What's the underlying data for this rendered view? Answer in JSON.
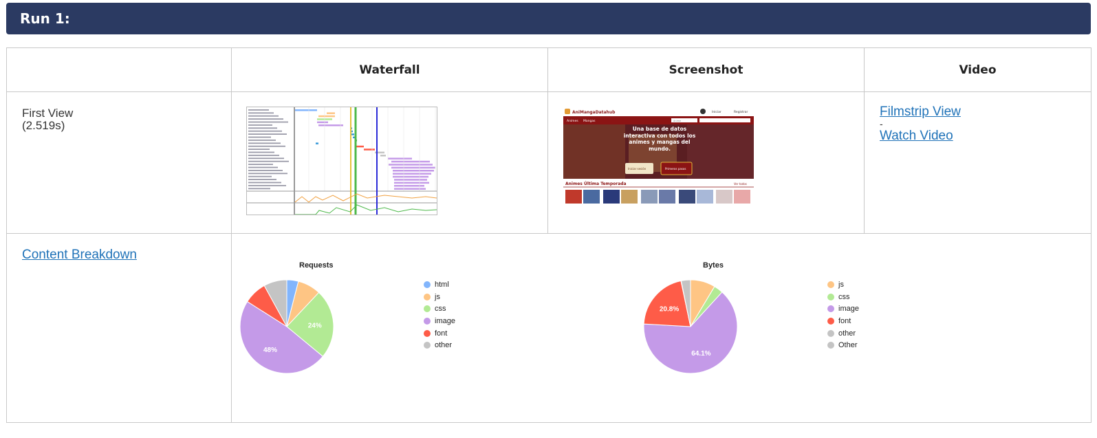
{
  "run": {
    "title": "Run 1:"
  },
  "table": {
    "headers": [
      "",
      "Waterfall",
      "Screenshot",
      "Video"
    ]
  },
  "first_view": {
    "label": "First View",
    "time": "(2.519s)",
    "filmstrip_link": "Filmstrip View",
    "separator": "-",
    "video_link": "Watch Video"
  },
  "screenshot": {
    "logo_text": "AniMangaDatahub",
    "nav": [
      "Animes",
      "Mangas"
    ],
    "user_links": [
      "Iniciar",
      "Registrar"
    ],
    "search_placeholder": "Anime",
    "hero_text": "Una base de datos interactiva con todos los animes y mangas del mundo.",
    "btn_login": "Iniciar sesión",
    "btn_start": "Primeros pasos",
    "section_title": "Animes Última Temporada",
    "see_all": "Ver todos"
  },
  "breakdown": {
    "link": "Content Breakdown"
  },
  "colors": {
    "header_bg": "#2b3a62",
    "link": "#1f72b8",
    "html": "#82b5fc",
    "js": "#fec584",
    "css": "#b2ea94",
    "image": "#c49ae8",
    "font": "#fe5c48",
    "other": "#c4c4c4"
  },
  "chart_data": [
    {
      "type": "pie",
      "title": "Requests",
      "series": [
        {
          "name": "html",
          "value": 4,
          "color": "#82b5fc"
        },
        {
          "name": "js",
          "value": 8,
          "color": "#fec584"
        },
        {
          "name": "css",
          "value": 24,
          "color": "#b2ea94"
        },
        {
          "name": "image",
          "value": 48,
          "color": "#c49ae8"
        },
        {
          "name": "font",
          "value": 8,
          "color": "#fe5c48"
        },
        {
          "name": "other",
          "value": 8,
          "color": "#c4c4c4"
        }
      ],
      "labels": {
        "css": "24%",
        "image": "48%"
      },
      "legend_position": "right"
    },
    {
      "type": "pie",
      "title": "Bytes",
      "series": [
        {
          "name": "js",
          "value": 8.6,
          "color": "#fec584"
        },
        {
          "name": "css",
          "value": 3.2,
          "color": "#b2ea94"
        },
        {
          "name": "image",
          "value": 64.1,
          "color": "#c49ae8"
        },
        {
          "name": "font",
          "value": 20.8,
          "color": "#fe5c48"
        },
        {
          "name": "other",
          "value": 0.1,
          "color": "#c4c4c4"
        },
        {
          "name": "Other",
          "value": 3.2,
          "color": "#c4c4c4"
        }
      ],
      "labels": {
        "image": "64.1%",
        "font": "20.8%"
      },
      "legend_position": "right"
    }
  ]
}
